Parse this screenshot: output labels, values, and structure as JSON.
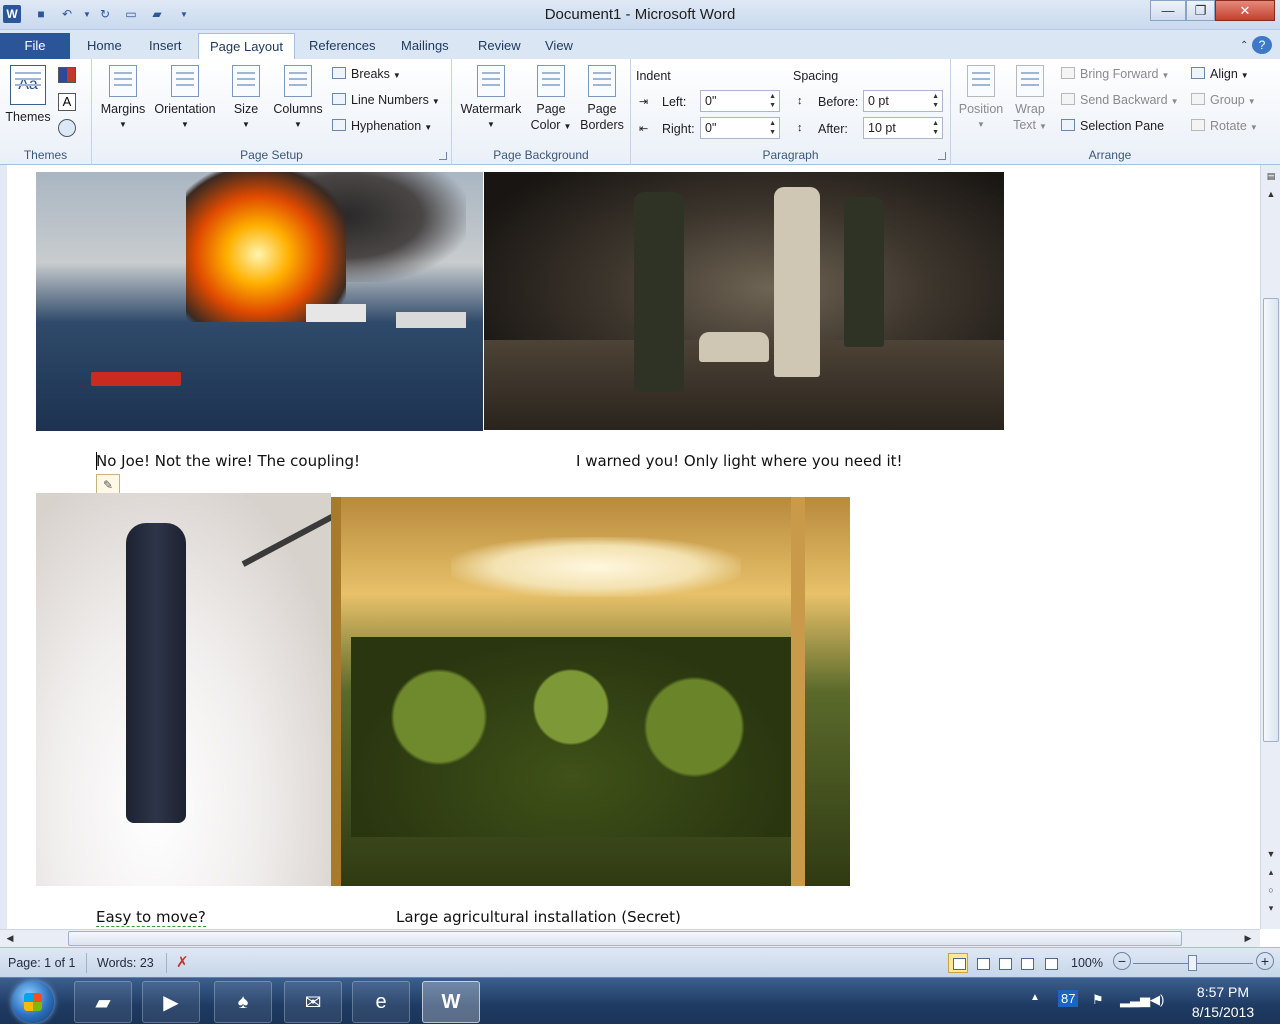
{
  "window": {
    "title": "Document1  -  Microsoft Word",
    "app_icon": "W",
    "controls": {
      "minimize": "—",
      "maximize": "❐",
      "close": "✕"
    }
  },
  "tabs": [
    {
      "label": "File"
    },
    {
      "label": "Home"
    },
    {
      "label": "Insert"
    },
    {
      "label": "Page Layout",
      "active": true
    },
    {
      "label": "References"
    },
    {
      "label": "Mailings"
    },
    {
      "label": "Review"
    },
    {
      "label": "View"
    }
  ],
  "ribbon": {
    "themes": {
      "themes_label": "Themes",
      "group": "Themes"
    },
    "page_setup": {
      "margins": "Margins",
      "orientation": "Orientation",
      "size": "Size",
      "columns": "Columns",
      "breaks": "Breaks",
      "line_numbers": "Line Numbers",
      "hyphenation": "Hyphenation",
      "group": "Page Setup"
    },
    "page_background": {
      "watermark": "Watermark",
      "page_color_1": "Page",
      "page_color_2": "Color",
      "page_borders_1": "Page",
      "page_borders_2": "Borders",
      "group": "Page Background"
    },
    "paragraph": {
      "indent": "Indent",
      "left_label": "Left:",
      "left_value": "0\"",
      "right_label": "Right:",
      "right_value": "0\"",
      "spacing": "Spacing",
      "before_label": "Before:",
      "before_value": "0 pt",
      "after_label": "After:",
      "after_value": "10 pt",
      "group": "Paragraph"
    },
    "arrange": {
      "position_1": "Position",
      "wrap_1": "Wrap",
      "wrap_2": "Text",
      "bring_forward": "Bring Forward",
      "send_backward": "Send Backward",
      "selection_pane": "Selection Pane",
      "align": "Align",
      "group_btn": "Group",
      "rotate": "Rotate",
      "group": "Arrange"
    }
  },
  "document": {
    "captions": {
      "rig": "No Joe! Not the wire! The coupling!",
      "soldiers": "I warned you! Only light where you need it!",
      "hanging": "Easy to move?",
      "grow": "Large agricultural  installation (Secret)"
    }
  },
  "status": {
    "page": "Page: 1 of 1",
    "words": "Words: 23",
    "zoom": "100%",
    "zoom_minus": "−",
    "zoom_plus": "+"
  },
  "taskbar": {
    "tray_badge": "87",
    "time": "8:57 PM",
    "date": "8/15/2013"
  }
}
